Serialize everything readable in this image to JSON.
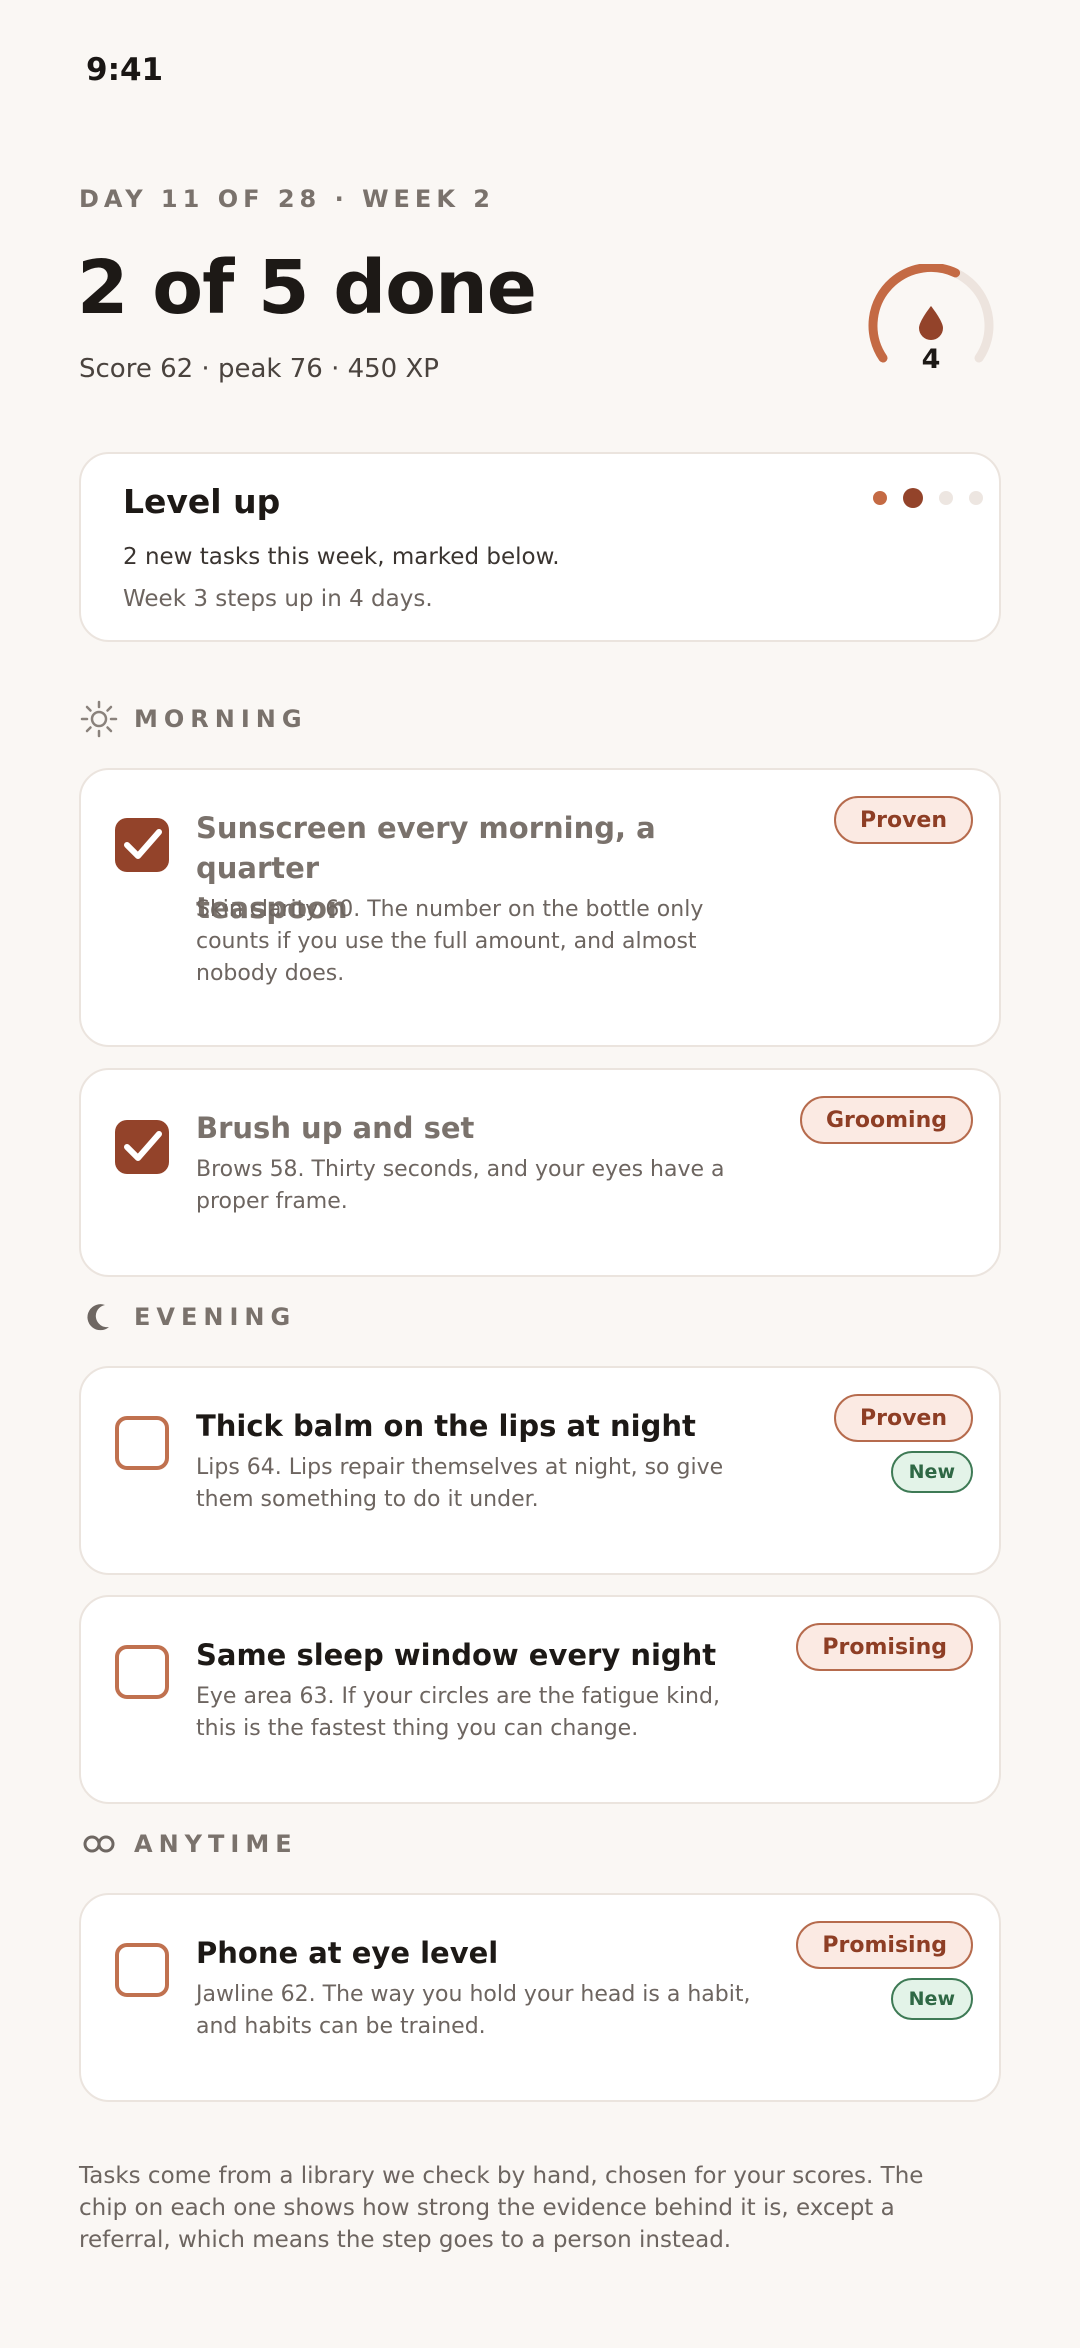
{
  "status": {
    "time": "9:41"
  },
  "header": {
    "eyebrow": "DAY 11 OF 28 · WEEK 2",
    "headline": "2 of 5 done",
    "score_line": "Score 62 · peak 76 · 450 XP"
  },
  "streak": {
    "value": "4",
    "progress": 0.6,
    "accent_color": "#c46a44",
    "track_color": "#ede4de",
    "icon": "drop-icon"
  },
  "level_up": {
    "title": "Level up",
    "line1": "2 new tasks this week, marked below.",
    "line2": "Week 3 steps up in 4 days.",
    "weeks": [
      "done",
      "current",
      "upcoming",
      "upcoming"
    ]
  },
  "sections": {
    "morning": {
      "label": "MORNING",
      "icon": "sun-icon"
    },
    "evening": {
      "label": "EVENING",
      "icon": "moon-icon"
    },
    "anytime": {
      "label": "ANYTIME",
      "icon": "infinity-icon"
    }
  },
  "tasks": [
    {
      "title_lines": [
        "Sunscreen every morning, a quarter",
        "teaspoon"
      ],
      "desc_lines": [
        "Skin clarity 60. The number on the bottle only",
        "counts if you use the full amount, and almost",
        "nobody does."
      ],
      "chip": "Proven",
      "new_chip": "",
      "checked": true
    },
    {
      "title_lines": [
        "Brush up and set"
      ],
      "desc_lines": [
        "Brows 58. Thirty seconds, and your eyes have a",
        "proper frame."
      ],
      "chip": "Grooming",
      "new_chip": "",
      "checked": true
    },
    {
      "title_lines": [
        "Thick balm on the lips at night"
      ],
      "desc_lines": [
        "Lips 64. Lips repair themselves at night, so give",
        "them something to do it under."
      ],
      "chip": "Proven",
      "new_chip": "New",
      "checked": false
    },
    {
      "title_lines": [
        "Same sleep window every night"
      ],
      "desc_lines": [
        "Eye area 63. If your circles are the fatigue kind,",
        "this is the fastest thing you can change."
      ],
      "chip": "Promising",
      "new_chip": "",
      "checked": false
    },
    {
      "title_lines": [
        "Phone at eye level"
      ],
      "desc_lines": [
        "Jawline 62. The way you hold your head is a habit,",
        "and habits can be trained."
      ],
      "chip": "Promising",
      "new_chip": "New",
      "checked": false
    }
  ],
  "footer": {
    "lines": [
      "Tasks come from a library we check by hand, chosen for your scores. The",
      "chip on each one shows how strong the evidence behind it is, except a",
      "referral, which means the step goes to a person instead."
    ]
  }
}
